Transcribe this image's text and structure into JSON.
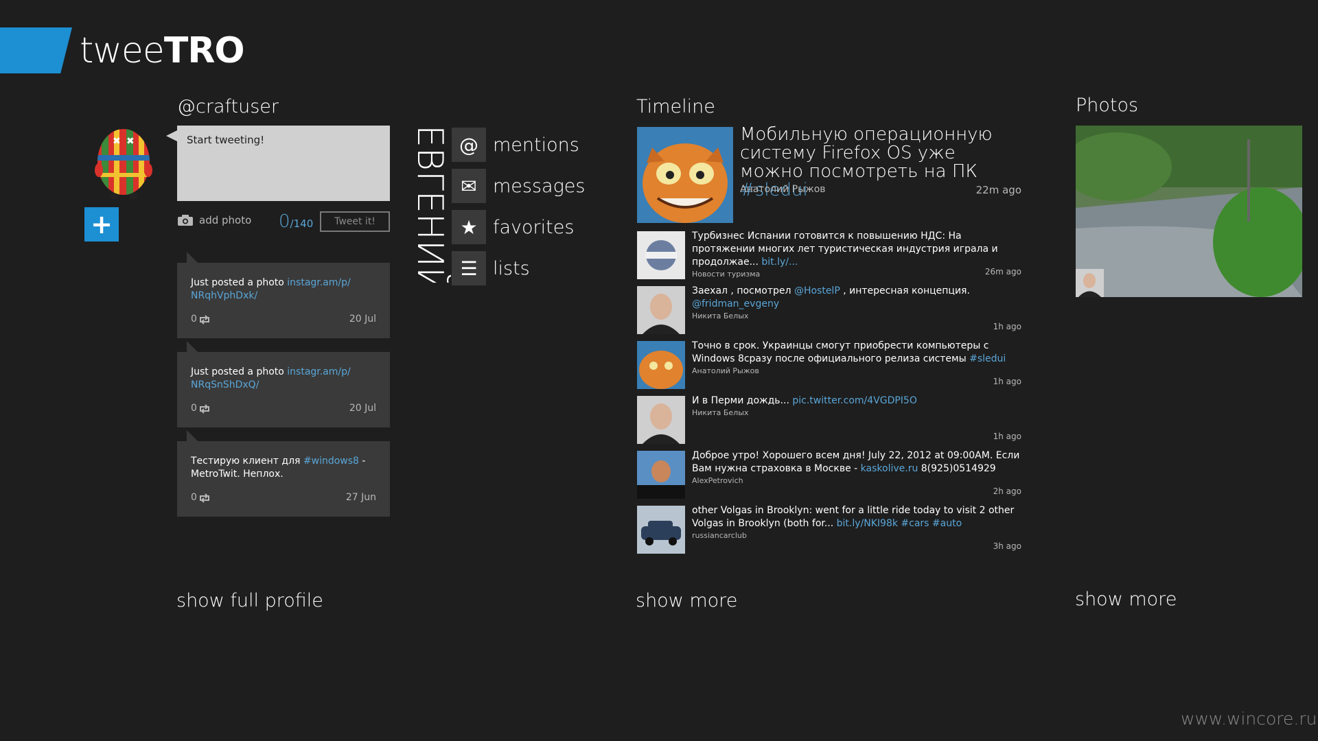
{
  "app": {
    "logo_light": "twee",
    "logo_bold": "TRO"
  },
  "profile": {
    "username": "@craftuser",
    "compose_placeholder": "Start tweeting!",
    "add_photo_label": "add photo",
    "char_count": "0",
    "char_limit": "/140",
    "tweet_button": "Tweet it!",
    "tweets": [
      {
        "text": "Just posted a photo ",
        "link": "instagr.am/p/ NRqhVphDxk/",
        "rest": "",
        "retweets": "0",
        "date": "20 Jul"
      },
      {
        "text": "Just posted a photo ",
        "link": "instagr.am/p/ NRqSnShDxQ/",
        "rest": "",
        "retweets": "0",
        "date": "20 Jul"
      },
      {
        "text": "Тестирую клиент для ",
        "link": "#windows8",
        "rest": " - MetroTwit. Неплох.",
        "retweets": "0",
        "date": "27 Jun"
      }
    ],
    "show_full_profile": "show full profile",
    "vertical_name": "ЕВГЕНИЙ"
  },
  "nav": {
    "items": [
      {
        "label": "mentions",
        "icon": "at-icon",
        "glyph": "@"
      },
      {
        "label": "messages",
        "icon": "envelope-icon",
        "glyph": "✉"
      },
      {
        "label": "favorites",
        "icon": "star-icon",
        "glyph": "★"
      },
      {
        "label": "lists",
        "icon": "list-icon",
        "glyph": "☰"
      }
    ]
  },
  "timeline": {
    "title": "Timeline",
    "featured": {
      "text": "Мобильную операционную систему Firefox OS уже можно посмотреть на ПК ",
      "hashtag": "#sledui",
      "author": "Анатолий Рыжов",
      "time": "22m ago"
    },
    "items": [
      {
        "text": "Турбизнес Испании готовится к повышению НДС: На протяжении многих лет туристическая индустрия играла и продолжае... ",
        "link": "bit.ly/...",
        "rest": "",
        "author": "Новости туризма",
        "time": "26m ago"
      },
      {
        "text": "Заехал , посмотрел ",
        "link": "@HostelP",
        "rest": " , интересная концепция.",
        "link2": "@fridman_evgeny",
        "author": "Никита Белых",
        "time": "1h ago"
      },
      {
        "text": "Точно в срок. Украинцы смогут приобрести компьютеры с Windows 8сразу после официального релиза системы ",
        "link": "#sledui",
        "rest": "",
        "author": "Анатолий Рыжов",
        "time": "1h ago"
      },
      {
        "text": "И в Перми дождь... ",
        "link": "pic.twitter.com/4VGDPI5O",
        "rest": "",
        "author": "Никита Белых",
        "time": "1h ago"
      },
      {
        "text": "Доброе утро! Хорошего всем дня! July 22, 2012 at 09:00AM. Если Вам нужна страховка в Москве - ",
        "link": "kaskolive.ru",
        "rest": " 8(925)0514929",
        "author": "AlexPetrovich",
        "time": "2h ago"
      },
      {
        "text": "other Volgas in Brooklyn: went for a little ride today to visit 2 other Volgas in Brooklyn (both for... ",
        "link": "bit.ly/NKI98k #cars #auto",
        "rest": "",
        "author": "russiancarclub",
        "time": "3h ago"
      }
    ],
    "show_more": "show more"
  },
  "photos": {
    "title": "Photos",
    "show_more": "show more"
  },
  "watermark": "www.wincore.ru",
  "colors": {
    "accent": "#1d8fd3",
    "background": "#1e1e1e",
    "link": "#5aa6d8",
    "card": "#3a3a3a"
  }
}
